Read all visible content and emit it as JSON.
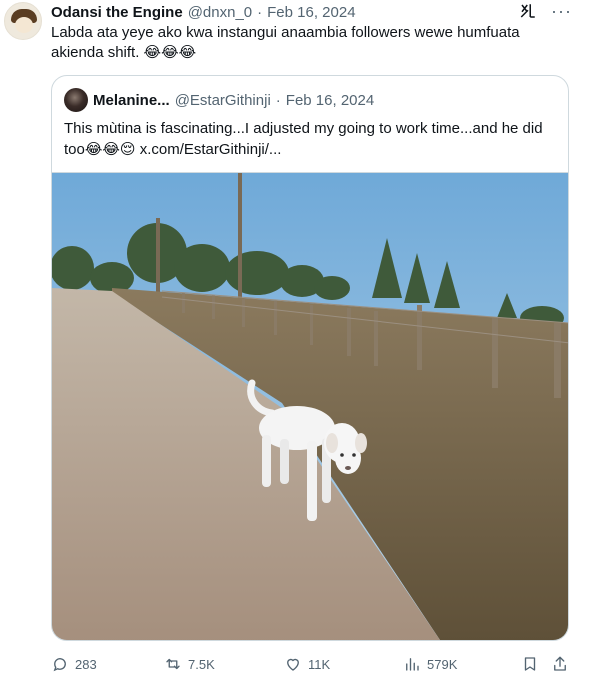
{
  "author": {
    "name": "Odansi the Engine",
    "handle": "@dnxn_0",
    "date": "Feb 16, 2024",
    "text": "Labda ata yeye ako kwa instangui anaambia followers wewe humfuata akienda shift. 😂😂😂"
  },
  "separator": "·",
  "quoted": {
    "name": "Melanine...",
    "handle": "@EstarGithinji",
    "date": "Feb 16, 2024",
    "text": "This mùtina is fascinating...I adjusted my going to work time...and he did too😂😂😌  x.com/EstarGithinji/...",
    "image_alt": "White dog walking on a dirt road beside a fence"
  },
  "actions": {
    "replies": "283",
    "reposts": "7.5K",
    "likes": "11K",
    "views": "579K"
  },
  "icons": [
    "grok-icon",
    "more-icon",
    "reply-icon",
    "repost-icon",
    "like-icon",
    "views-icon",
    "bookmark-icon",
    "share-icon"
  ],
  "colors": {
    "text": "#0f1419",
    "muted": "#536471",
    "border": "#cfd9de"
  }
}
